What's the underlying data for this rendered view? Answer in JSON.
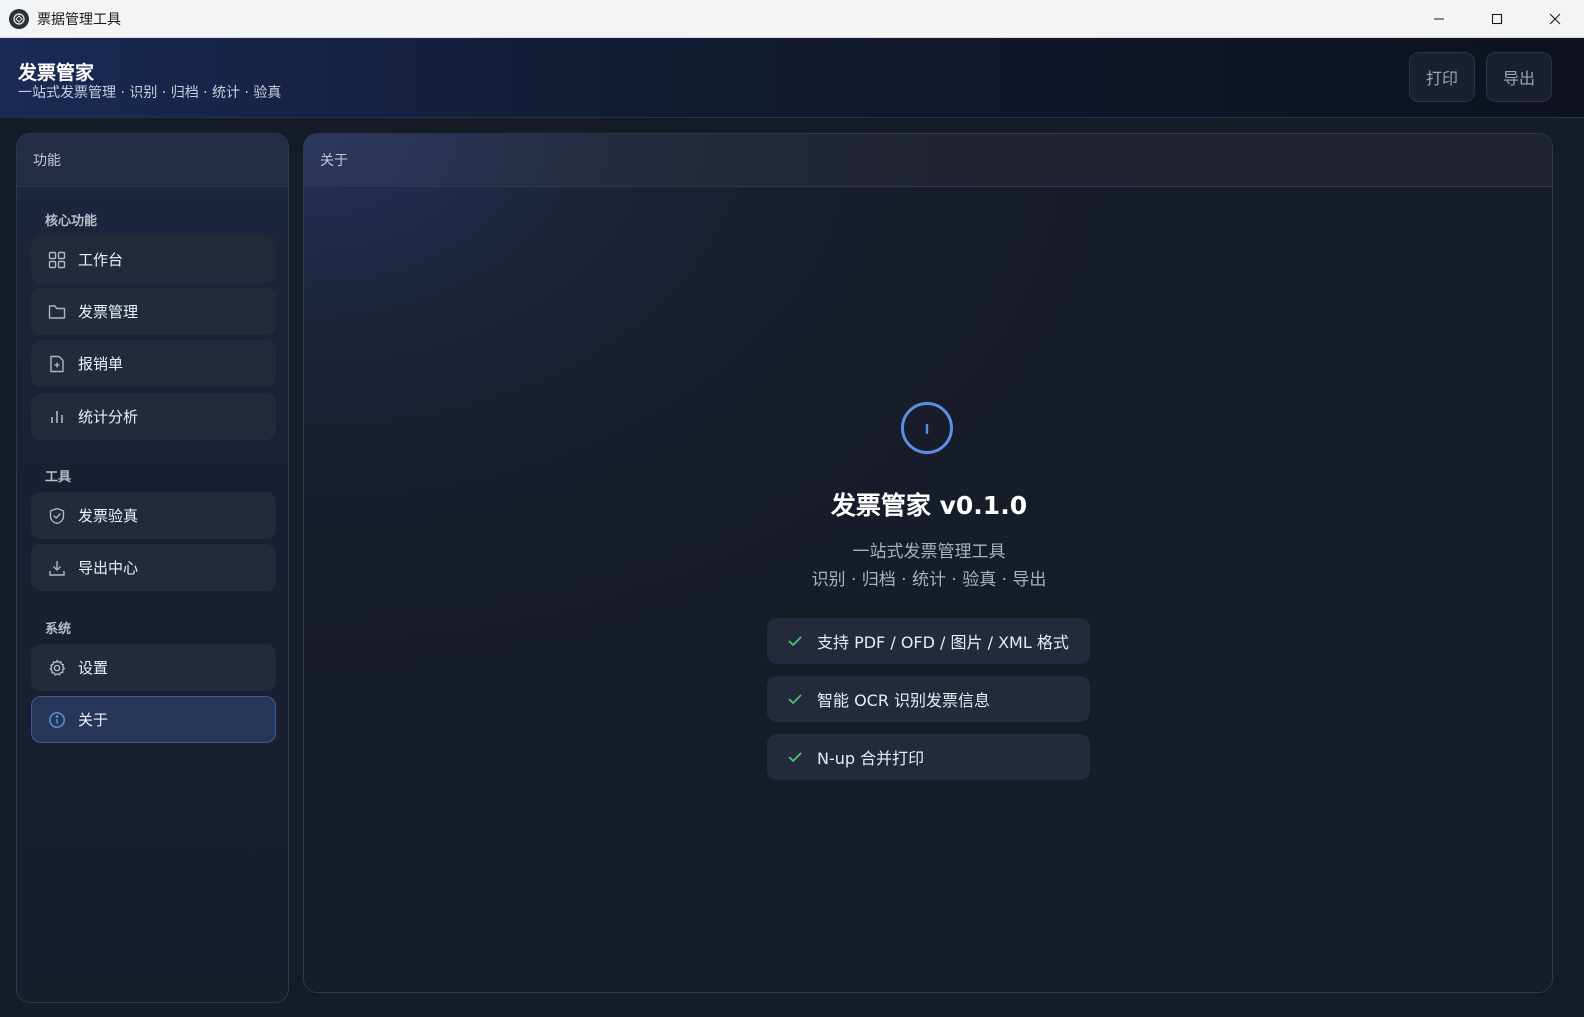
{
  "window": {
    "title": "票据管理工具"
  },
  "header": {
    "title": "发票管家",
    "subtitle": "一站式发票管理 · 识别 · 归档 · 统计 · 验真",
    "print_label": "打印",
    "export_label": "导出"
  },
  "sidebar": {
    "heading": "功能",
    "sections": [
      {
        "label": "核心功能"
      },
      {
        "label": "工具"
      },
      {
        "label": "系统"
      }
    ],
    "items": [
      {
        "label": "工作台",
        "icon": "grid-icon"
      },
      {
        "label": "发票管理",
        "icon": "folder-icon"
      },
      {
        "label": "报销单",
        "icon": "file-plus-icon"
      },
      {
        "label": "统计分析",
        "icon": "bar-chart-icon"
      },
      {
        "label": "发票验真",
        "icon": "shield-check-icon"
      },
      {
        "label": "导出中心",
        "icon": "download-icon"
      },
      {
        "label": "设置",
        "icon": "gear-icon"
      },
      {
        "label": "关于",
        "icon": "info-icon",
        "active": true
      }
    ]
  },
  "main": {
    "heading": "关于",
    "app_title": "发票管家 v0.1.0",
    "tagline": "一站式发票管理工具",
    "capabilities": "识别 · 归档 · 统计 · 验真 · 导出",
    "features": [
      "支持 PDF / OFD / 图片 / XML 格式",
      "智能 OCR 识别发票信息",
      "N-up 合并打印"
    ]
  },
  "colors": {
    "accent": "#5a8fe0",
    "check": "#4cc46b",
    "background": "#161b28"
  }
}
